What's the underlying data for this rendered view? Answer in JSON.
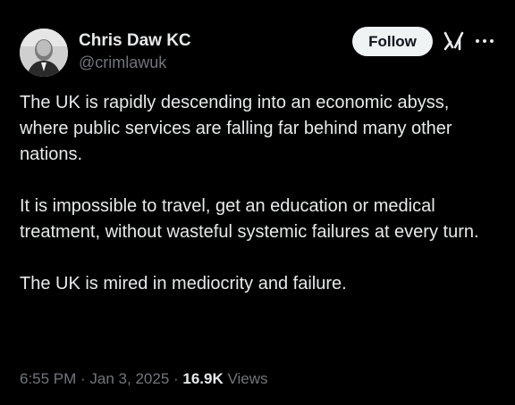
{
  "author": {
    "display_name": "Chris Daw KC",
    "handle": "@crimlawuk"
  },
  "actions": {
    "follow_label": "Follow",
    "grok_icon": "grok-icon",
    "more_icon": "more-dots-icon"
  },
  "tweet": {
    "paragraphs": [
      "The UK is rapidly descending into an economic abyss, where public services are falling far behind many other nations.",
      "It is impossible to travel, get an education or medical treatment, without wasteful systemic failures at every turn.",
      "The UK is mired in mediocrity and failure."
    ]
  },
  "meta": {
    "time": "6:55 PM",
    "separator": " · ",
    "date": "Jan 3, 2025",
    "views_count": "16.9K",
    "views_label": " Views"
  },
  "colors": {
    "background": "#000000",
    "primary_text": "#e7e9ea",
    "secondary_text": "#71767b",
    "follow_bg": "#eff3f4"
  }
}
